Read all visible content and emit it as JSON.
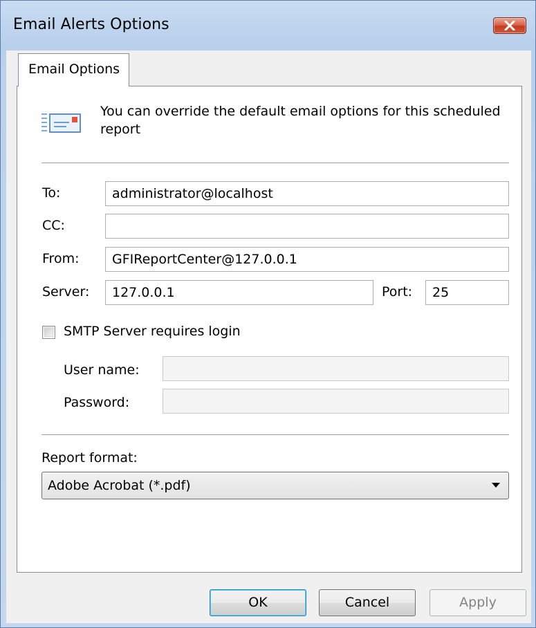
{
  "window": {
    "title": "Email Alerts Options"
  },
  "tabs": [
    {
      "label": "Email Options",
      "selected": true
    }
  ],
  "info": {
    "icon": "email-message-icon",
    "text": "You can override the default email options for this scheduled report"
  },
  "form": {
    "to": {
      "label": "To:",
      "value": "administrator@localhost"
    },
    "cc": {
      "label": "CC:",
      "value": ""
    },
    "from": {
      "label": "From:",
      "value": "GFIReportCenter@127.0.0.1"
    },
    "server": {
      "label": "Server:",
      "value": "127.0.0.1"
    },
    "port": {
      "label": "Port:",
      "value": "25"
    }
  },
  "smtp_login": {
    "label": "SMTP Server requires login",
    "checked": false,
    "username": {
      "label": "User name:",
      "value": ""
    },
    "password": {
      "label": "Password:",
      "value": ""
    }
  },
  "report_format": {
    "label": "Report format:",
    "selected": "Adobe Acrobat (*.pdf)"
  },
  "buttons": {
    "ok": "OK",
    "cancel": "Cancel",
    "apply": "Apply"
  },
  "colors": {
    "titlebar": "#b9d0ec",
    "close_button": "#c53a22",
    "default_button_border": "#3c7fb1"
  }
}
